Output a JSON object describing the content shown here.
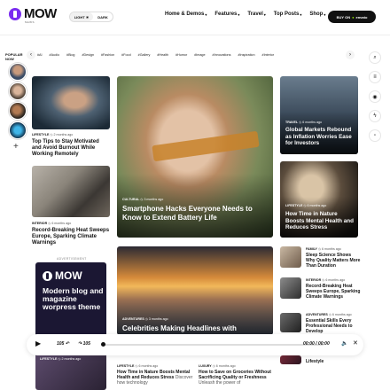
{
  "header": {
    "logo": "MOW",
    "logo_sub": "NEWS",
    "mode_light": "LIGHT",
    "mode_dark": "DARK",
    "nav": [
      "Home & Demos",
      "Features",
      "Travel",
      "Top Posts",
      "Shop"
    ],
    "buy_label": "BUY ON",
    "buy_brand": "envato"
  },
  "popular": {
    "label_line1": "POPULAR",
    "label_line2": "NOW",
    "add": "+"
  },
  "tags": [
    "#AI",
    "#Audio",
    "#Blog",
    "#Design",
    "#Fashion",
    "#Food",
    "#Gallery",
    "#Health",
    "#Humor",
    "#Image",
    "#Innovations",
    "#Inspiration",
    "#Interior"
  ],
  "left_col": [
    {
      "category": "LIFESTYLE",
      "date": "2 months ago",
      "title": "Top Tips to Stay Motivated and Avoid Burnout While Working Remotely"
    },
    {
      "category": "INTERIOR",
      "date": "6 months ago",
      "title": "Record-Breaking Heat Sweeps Europe, Sparking Climate Warnings"
    }
  ],
  "ad": {
    "label": "ADVERTISEMENT",
    "logo": "MOW",
    "title": "Modern blog and magazine worpress theme"
  },
  "hero": {
    "category": "CULTURAL",
    "date": "3 months ago",
    "title": "Smartphone Hacks Everyone Needs to Know to Extend Battery Life"
  },
  "second": {
    "category": "ADVENTURES",
    "date": "3 months ago",
    "title": "Celebrities Making Headlines with"
  },
  "bottom_mid": [
    {
      "category": "LIFESTYLE",
      "date": "6 months ago",
      "title": "How Time in Nature Boosts Mental Health and Reduces Stress",
      "excerpt": "Discover how technology"
    },
    {
      "category": "LUXURY",
      "date": "6 months ago",
      "title": "How to Save on Groceries Without Sacrificing Quality or Freshness",
      "excerpt": "Unleash the power of"
    }
  ],
  "bottom_left": {
    "category": "LIFESTYLE",
    "date": "2 months ago"
  },
  "right_col": [
    {
      "category": "TRAVEL",
      "date": "6 months ago",
      "title": "Global Markets Rebound as Inflation Worries Ease for Investors"
    },
    {
      "category": "LIFESTYLE",
      "date": "6 months ago",
      "title": "How Time in Nature Boosts Mental Health and Reduces Stress"
    }
  ],
  "right_list": [
    {
      "category": "FAMILY",
      "date": "6 months ago",
      "title": "Sleep Science Shows Why Quality Matters More Than Duration"
    },
    {
      "category": "INTERIOR",
      "date": "6 months ago",
      "title": "Record-Breaking Heat Sweeps Europe, Sparking Climate Warnings"
    },
    {
      "category": "ADVENTURES",
      "date": "6 months ago",
      "title": "Essential Skills Every Professional Needs to Develop"
    },
    {
      "title": "Lifestyle"
    }
  ],
  "player": {
    "skip_back": "105",
    "skip_fwd": "105",
    "time": "00:00 / 00:00",
    "progress": 0
  },
  "colors": {
    "brand": "#7a2cf0",
    "envato": "#8ee000",
    "ad_bg": "#1b1733"
  }
}
